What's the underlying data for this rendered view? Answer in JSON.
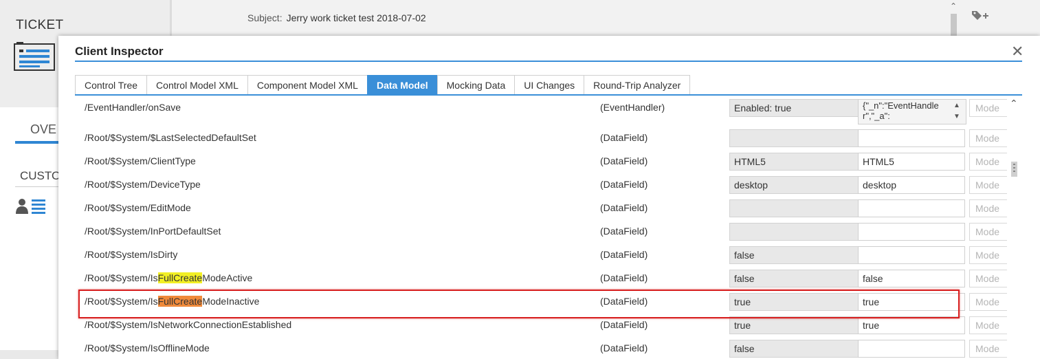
{
  "background": {
    "ticket_label": "TICKET",
    "overview_tab": "OVE",
    "customer_label": "CUSTO",
    "subject_label": "Subject:",
    "subject_value": "Jerry work ticket test 2018-07-02",
    "tag_icon": "tag-plus-icon"
  },
  "dialog": {
    "title": "Client Inspector",
    "close_icon": "close-icon",
    "tabs": [
      {
        "label": "Control Tree"
      },
      {
        "label": "Control Model XML"
      },
      {
        "label": "Component Model XML"
      },
      {
        "label": "Data Model",
        "active": true
      },
      {
        "label": "Mocking Data"
      },
      {
        "label": "UI Changes"
      },
      {
        "label": "Round-Trip Analyzer"
      }
    ],
    "highlight_term": "FullCreate",
    "rows": [
      {
        "path": "/EventHandler/onSave",
        "type": "(EventHandler)",
        "old": "Enabled: true",
        "new": "{\"_n\":\"EventHandler\",\"_a\":",
        "mode": "Mode"
      },
      {
        "path": "/Root/$System/$LastSelectedDefaultSet",
        "type": "(DataField)",
        "old": "",
        "new": "",
        "mode": "Mode"
      },
      {
        "path": "/Root/$System/ClientType",
        "type": "(DataField)",
        "old": "HTML5",
        "new": "HTML5",
        "mode": "Mode"
      },
      {
        "path": "/Root/$System/DeviceType",
        "type": "(DataField)",
        "old": "desktop",
        "new": "desktop",
        "mode": "Mode"
      },
      {
        "path": "/Root/$System/EditMode",
        "type": "(DataField)",
        "old": "",
        "new": "",
        "mode": "Mode"
      },
      {
        "path": "/Root/$System/InPortDefaultSet",
        "type": "(DataField)",
        "old": "",
        "new": "",
        "mode": "Mode"
      },
      {
        "path": "/Root/$System/IsDirty",
        "type": "(DataField)",
        "old": "false",
        "new": "",
        "mode": "Mode"
      },
      {
        "path_pre": "/Root/$System/Is",
        "path_hl": "FullCreate",
        "path_post": "ModeActive",
        "hl": "yellow",
        "type": "(DataField)",
        "old": "false",
        "new": "false",
        "mode": "Mode"
      },
      {
        "path_pre": "/Root/$System/Is",
        "path_hl": "FullCreate",
        "path_post": "ModeInactive",
        "hl": "orange",
        "type": "(DataField)",
        "old": "true",
        "new": "true",
        "mode": "Mode",
        "selected": true
      },
      {
        "path": "/Root/$System/IsNetworkConnectionEstablished",
        "type": "(DataField)",
        "old": "true",
        "new": "true",
        "mode": "Mode"
      },
      {
        "path": "/Root/$System/IsOfflineMode",
        "type": "(DataField)",
        "old": "false",
        "new": "",
        "mode": "Mode"
      }
    ]
  },
  "colors": {
    "accent": "#3a8fd8",
    "highlight_yellow": "#f2ef24",
    "highlight_orange": "#f08a3a",
    "selection_box": "#d81f1f"
  }
}
